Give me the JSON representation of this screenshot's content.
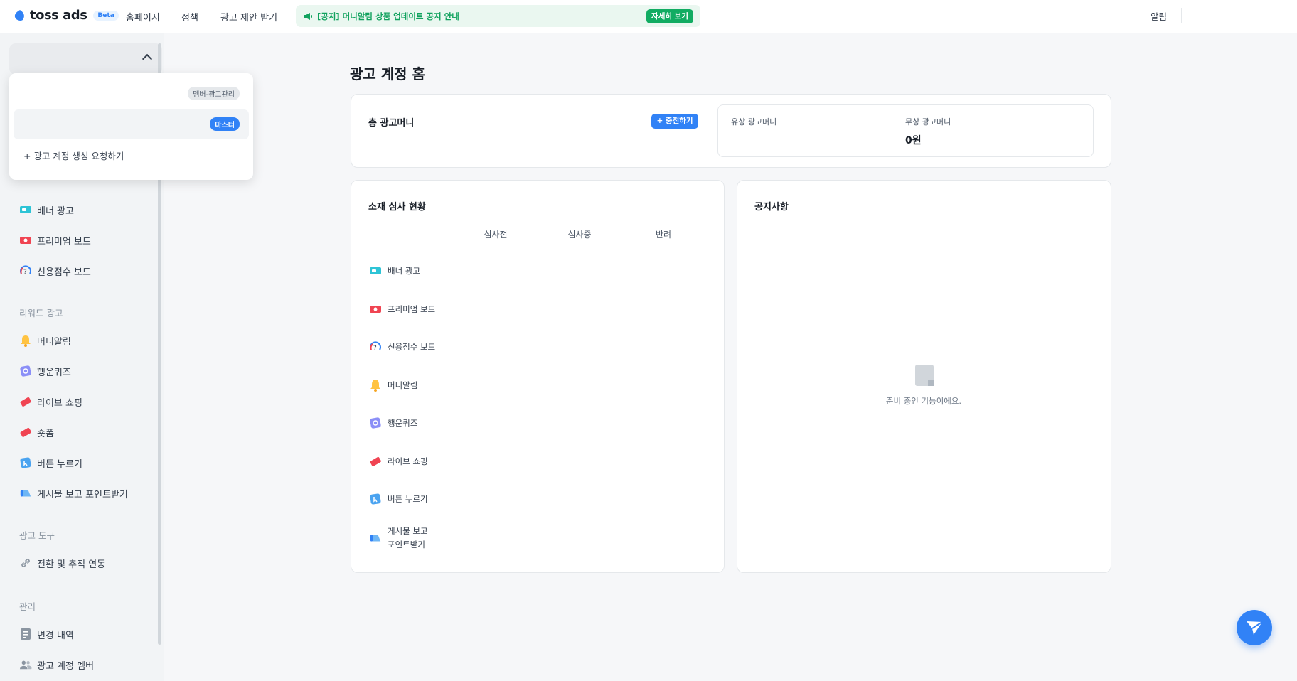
{
  "header": {
    "logo_text": "toss ads",
    "beta_label": "Beta",
    "nav": [
      "홈페이지",
      "정책",
      "광고 제안 받기"
    ],
    "notice_text": "[공지] 머니알림 상품 업데이트 공지 안내",
    "notice_button": "자세히 보기",
    "alarm_label": "알림"
  },
  "account_dropdown": {
    "role_badge_1": "멤버-광고관리",
    "role_badge_2": "마스터",
    "create_label": "+ 광고 계정 생성 요청하기"
  },
  "sidebar": {
    "display_items": [
      {
        "label": "배너 광고",
        "icon": "banner-ad-icon"
      },
      {
        "label": "프리미엄 보드",
        "icon": "premium-board-icon"
      },
      {
        "label": "신용점수 보드",
        "icon": "credit-score-board-icon"
      }
    ],
    "reward_group": "리워드 광고",
    "reward_items": [
      {
        "label": "머니알림",
        "icon": "bell-icon"
      },
      {
        "label": "행운퀴즈",
        "icon": "quiz-icon"
      },
      {
        "label": "라이브 쇼핑",
        "icon": "ticket-icon"
      },
      {
        "label": "숏폼",
        "icon": "ticket-icon"
      },
      {
        "label": "버튼 누르기",
        "icon": "button-press-icon"
      },
      {
        "label": "게시물 보고 포인트받기",
        "icon": "post-point-icon"
      }
    ],
    "tools_group": "광고 도구",
    "tools_items": [
      {
        "label": "전환 및 추적 연동",
        "icon": "link-icon"
      }
    ],
    "manage_group": "관리",
    "manage_items": [
      {
        "label": "변경 내역",
        "icon": "document-icon"
      },
      {
        "label": "광고 계정 멤버",
        "icon": "members-icon"
      }
    ]
  },
  "main": {
    "page_title": "광고 계정 홈",
    "money_card": {
      "title": "총 광고머니",
      "charge_button": "+ 충전하기",
      "paid_label": "유상 광고머니",
      "free_label": "무상 광고머니",
      "free_value": "0원"
    },
    "review_card": {
      "title": "소재 심사 현황",
      "columns": [
        "심사전",
        "심사중",
        "반려"
      ],
      "rows": [
        {
          "label": "배너 광고",
          "icon": "banner-ad-icon"
        },
        {
          "label": "프리미엄 보드",
          "icon": "premium-board-icon"
        },
        {
          "label": "신용점수 보드",
          "icon": "credit-score-board-icon"
        },
        {
          "label": "머니알림",
          "icon": "bell-icon"
        },
        {
          "label": "행운퀴즈",
          "icon": "quiz-icon"
        },
        {
          "label": "라이브 쇼핑",
          "icon": "ticket-icon"
        },
        {
          "label": "버튼 누르기",
          "icon": "button-press-icon"
        },
        {
          "label": "게시물 보고",
          "label2": "포인트받기",
          "icon": "post-point-icon"
        }
      ]
    },
    "notice_card": {
      "title": "공지사항",
      "empty_text": "준비 중인 기능이에요."
    }
  },
  "colors": {
    "brand_blue": "#3182f6",
    "notice_green": "#11a25e",
    "sidebar_bg": "#f2f4f6"
  }
}
